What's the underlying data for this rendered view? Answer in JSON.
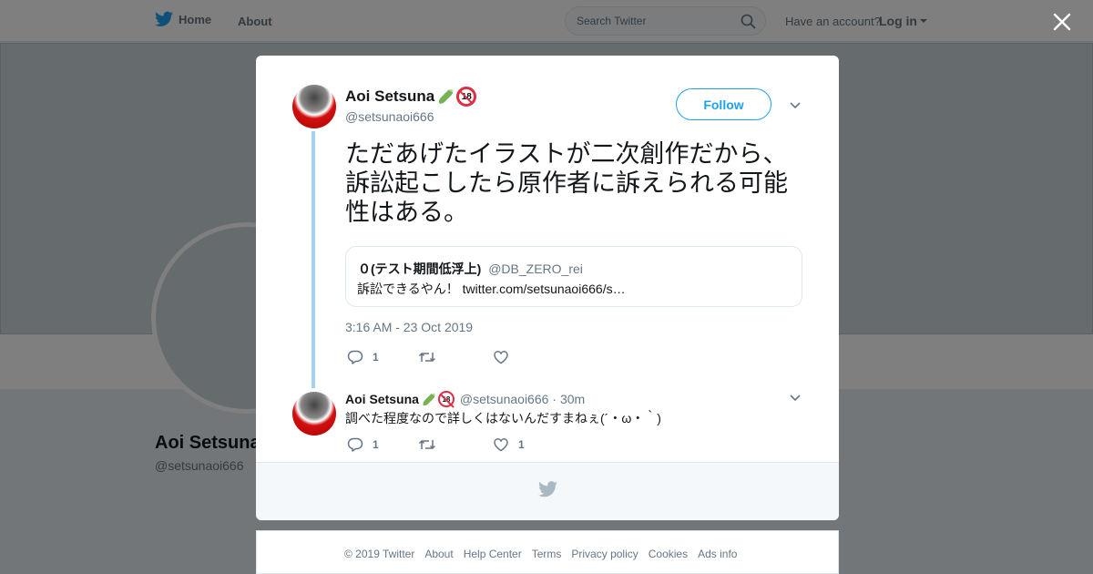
{
  "nav": {
    "home_label": "Home",
    "about_label": "About",
    "search_placeholder": "Search Twitter",
    "have_account": "Have an account?",
    "login_label": "Log in"
  },
  "profile": {
    "name": "Aoi Setsuna",
    "handle": "@setsunaoi666"
  },
  "tweet": {
    "author_name": "Aoi Setsuna",
    "author_handle": "@setsunaoi666",
    "follow_label": "Follow",
    "text": "ただあげたイラストが二次創作だから、訴訟起こしたら原作者に訴えられる可能性はある。",
    "quote": {
      "name": "０(テスト期間低浮上)",
      "handle": "@DB_ZERO_rei",
      "text": "訴訟できるやん！ twitter.com/setsunaoi666/s…"
    },
    "timestamp": "3:16 AM - 23 Oct 2019",
    "reply_count": "1"
  },
  "reply": {
    "author_name": "Aoi Setsuna",
    "author_handle": "@setsunaoi666",
    "time": "· 30m",
    "text": "調べた程度なので詳しくはないんだすまねぇ(´・ω・｀)",
    "reply_count": "1",
    "like_count": "1"
  },
  "footer": {
    "links": [
      "© 2019 Twitter",
      "About",
      "Help Center",
      "Terms",
      "Privacy policy",
      "Cookies",
      "Ads info"
    ]
  },
  "colors": {
    "accent": "#1da1f2",
    "thread_line": "#a6d1f0",
    "muted": "#657786"
  },
  "icons": [
    "twitter-bird-icon",
    "search-icon",
    "close-icon",
    "chevron-down-icon",
    "reply-icon",
    "retweet-icon",
    "like-icon",
    "cucumber-emoji",
    "no-under-18-emoji"
  ]
}
